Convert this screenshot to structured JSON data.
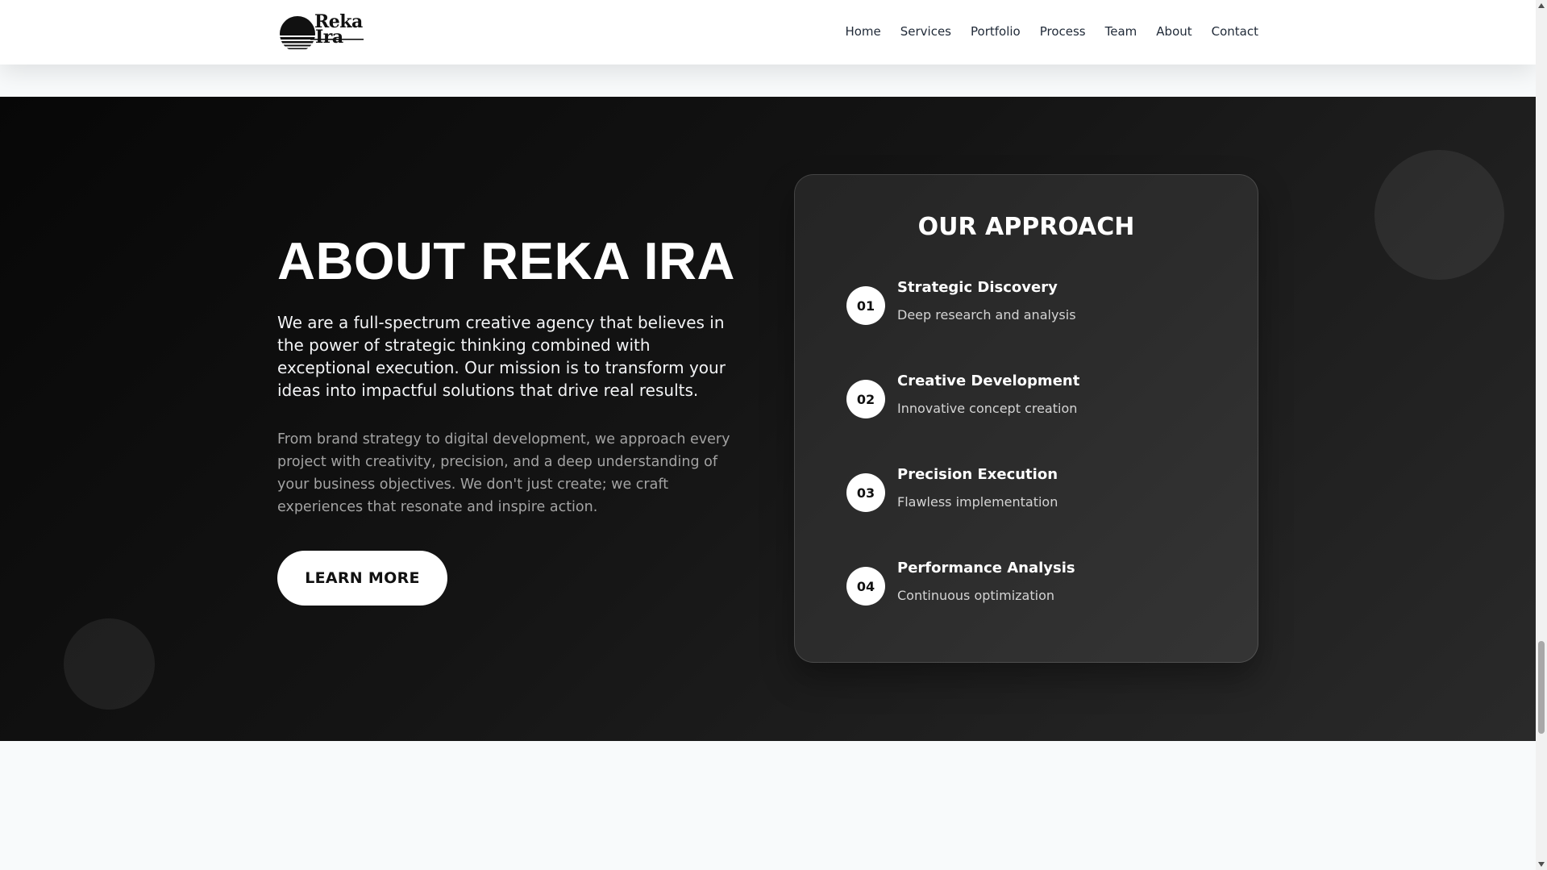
{
  "brand": {
    "name_line1": "Reka",
    "name_line2": "Ira"
  },
  "nav": {
    "items": [
      {
        "label": "Home"
      },
      {
        "label": "Services"
      },
      {
        "label": "Portfolio"
      },
      {
        "label": "Process"
      },
      {
        "label": "Team"
      },
      {
        "label": "About"
      },
      {
        "label": "Contact"
      }
    ]
  },
  "about": {
    "title": "ABOUT REKA IRA",
    "lead": "We are a full-spectrum creative agency that believes in the power of strategic thinking combined with exceptional execution. Our mission is to transform your ideas into impactful solutions that drive real results.",
    "body": "From brand strategy to digital development, we approach every project with creativity, precision, and a deep understanding of your business objectives. We don't just create; we craft experiences that resonate and inspire action.",
    "cta_label": "LEARN MORE"
  },
  "approach": {
    "title": "OUR APPROACH",
    "steps": [
      {
        "number": "01",
        "title": "Strategic Discovery",
        "description": "Deep research and analysis"
      },
      {
        "number": "02",
        "title": "Creative Development",
        "description": "Innovative concept creation"
      },
      {
        "number": "03",
        "title": "Precision Execution",
        "description": "Flawless implementation"
      },
      {
        "number": "04",
        "title": "Performance Analysis",
        "description": "Continuous optimization"
      }
    ]
  },
  "colors": {
    "section_dark": "#0a0a0a",
    "header_bg": "#ffffff",
    "text_light": "#ffffff",
    "text_muted": "#a3a3a3"
  }
}
